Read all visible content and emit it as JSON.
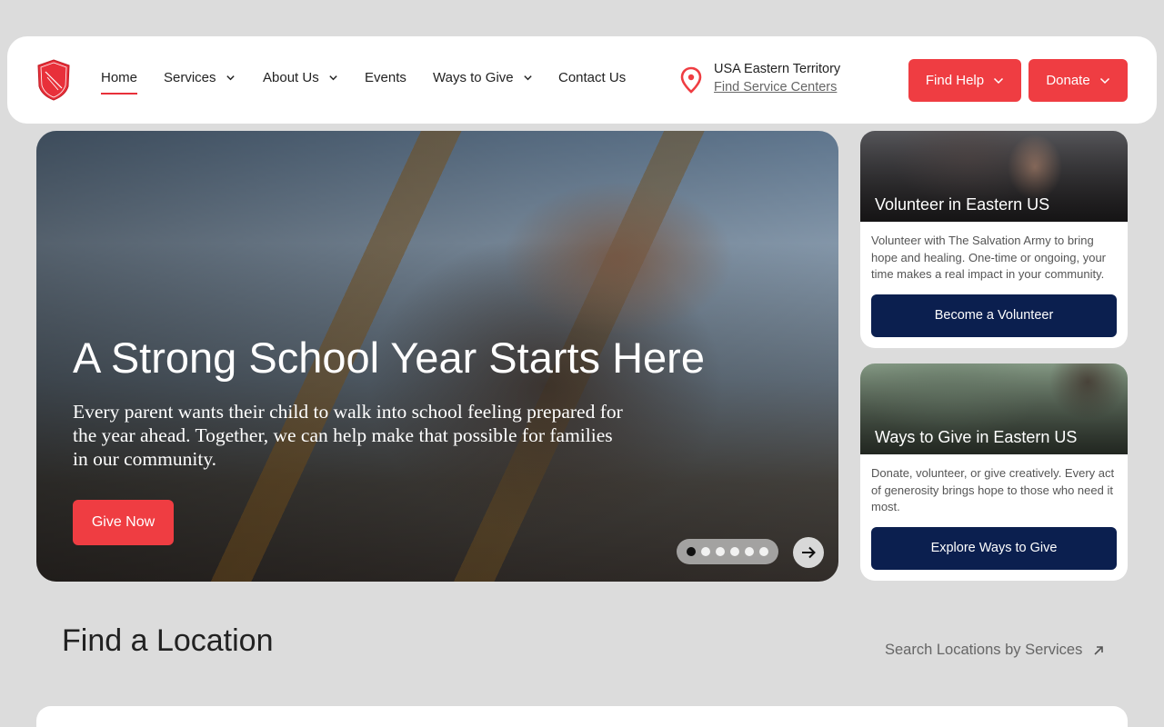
{
  "header": {
    "nav": [
      {
        "label": "Home",
        "dropdown": false,
        "active": true
      },
      {
        "label": "Services",
        "dropdown": true
      },
      {
        "label": "About Us",
        "dropdown": true
      },
      {
        "label": "Events",
        "dropdown": false
      },
      {
        "label": "Ways to Give",
        "dropdown": true
      },
      {
        "label": "Contact Us",
        "dropdown": false
      }
    ],
    "location": {
      "territory": "USA Eastern Territory",
      "link": "Find Service Centers"
    },
    "buttons": {
      "find_help": "Find Help",
      "donate": "Donate"
    }
  },
  "hero": {
    "title": "A Strong School Year Starts Here",
    "text": "Every parent wants their child to walk into school feeling prepared for the year ahead. Together, we can help make that possible for families in our community.",
    "cta": "Give Now",
    "slides": 6,
    "active_slide": 1
  },
  "cards": [
    {
      "title": "Volunteer in Eastern US",
      "body": "Volunteer with The Salvation Army to bring hope and healing. One-time or ongoing, your time makes a real impact in your community.",
      "button": "Become a Volunteer"
    },
    {
      "title": "Ways to Give in Eastern US",
      "body": "Donate, volunteer, or give creatively. Every act of generosity brings hope to those who need it most.",
      "button": "Explore Ways to Give"
    }
  ],
  "find_location": {
    "title": "Find a Location",
    "link": "Search Locations by Services"
  },
  "colors": {
    "brand_red": "#ef3d42",
    "navy": "#0b1f4f",
    "background": "#dcdcdc"
  }
}
